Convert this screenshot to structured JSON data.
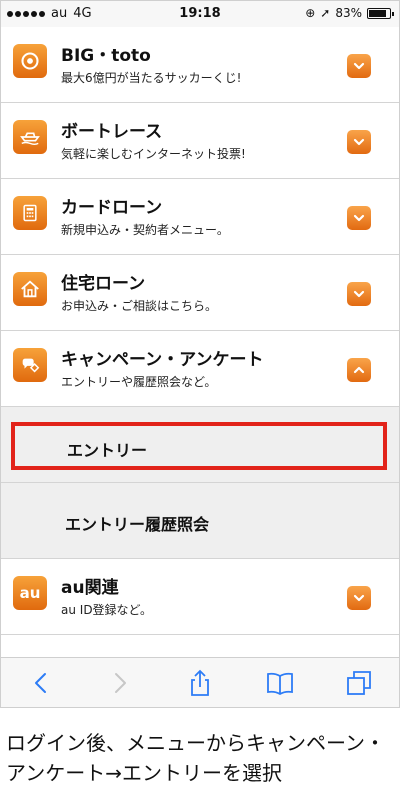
{
  "status_bar": {
    "carrier": "au",
    "network": "4G",
    "time": "19:18",
    "battery": "83%",
    "battery_level": 0.83
  },
  "menu": {
    "items": [
      {
        "title": "BIG・toto",
        "subtitle": "最大6億円が当たるサッカーくじ!",
        "icon": "soccer-ball-icon",
        "expanded": false
      },
      {
        "title": "ボートレース",
        "subtitle": "気軽に楽しむインターネット投票!",
        "icon": "boat-icon",
        "expanded": false
      },
      {
        "title": "カードローン",
        "subtitle": "新規申込み・契約者メニュー。",
        "icon": "calculator-icon",
        "expanded": false
      },
      {
        "title": "住宅ローン",
        "subtitle": "お申込み・ご相談はこちら。",
        "icon": "house-icon",
        "expanded": false
      },
      {
        "title": "キャンペーン・アンケート",
        "subtitle": "エントリーや履歴照会など。",
        "icon": "campaign-icon",
        "expanded": true
      }
    ],
    "submenu": [
      {
        "label": "エントリー"
      },
      {
        "label": "エントリー履歴照会"
      }
    ],
    "last_item": {
      "title": "au関連",
      "subtitle": "au ID登録など。",
      "icon_text": "au",
      "expanded": false
    }
  },
  "caption": "ログイン後、メニューからキャンペーン・アンケート→エントリーを選択",
  "colors": {
    "accent": "#ee7d16",
    "highlight": "#e2231a"
  }
}
